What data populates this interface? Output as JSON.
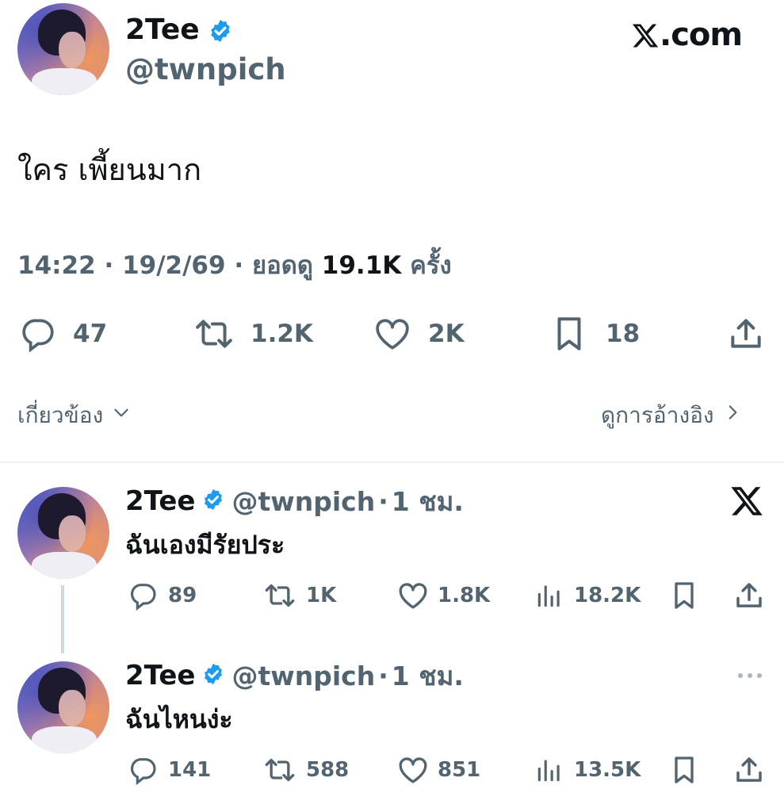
{
  "main_tweet": {
    "author_name": "2Tee",
    "author_handle": "@twnpich",
    "brand": "X.com",
    "text": "ใคร เพี้ยนมาก",
    "meta": {
      "time": "14:22",
      "sep1": "·",
      "date": "19/2/69",
      "sep2": "·",
      "views_label": "ยอดดู",
      "views_value": "19.1K",
      "views_unit": "ครั้ง"
    },
    "actions": {
      "replies": "47",
      "retweets": "1.2K",
      "likes": "2K",
      "bookmarks": "18"
    },
    "related_label": "เกี่ยวข้อง",
    "quotes_label": "ดูการอ้างอิง"
  },
  "replies": [
    {
      "author_name": "2Tee",
      "author_handle": "@twnpich",
      "sep": "·",
      "time": "1 ชม.",
      "text": "ฉันเองมีรัยประ",
      "replies": "89",
      "retweets": "1K",
      "likes": "1.8K",
      "views": "18.2K"
    },
    {
      "author_name": "2Tee",
      "author_handle": "@twnpich",
      "sep": "·",
      "time": "1 ชม.",
      "text": "ฉันไหนง่ะ",
      "replies": "141",
      "retweets": "588",
      "likes": "851",
      "views": "13.5K"
    }
  ],
  "colors": {
    "verified": "#1d9bf0",
    "text": "#0f1419",
    "muted": "#536471",
    "divider": "#eff3f4"
  },
  "icons": [
    "verified-badge-icon",
    "reply-icon",
    "retweet-icon",
    "like-icon",
    "bookmark-icon",
    "share-icon",
    "views-icon",
    "chevron-down-icon",
    "chevron-right-icon",
    "x-logo-icon",
    "more-icon"
  ]
}
